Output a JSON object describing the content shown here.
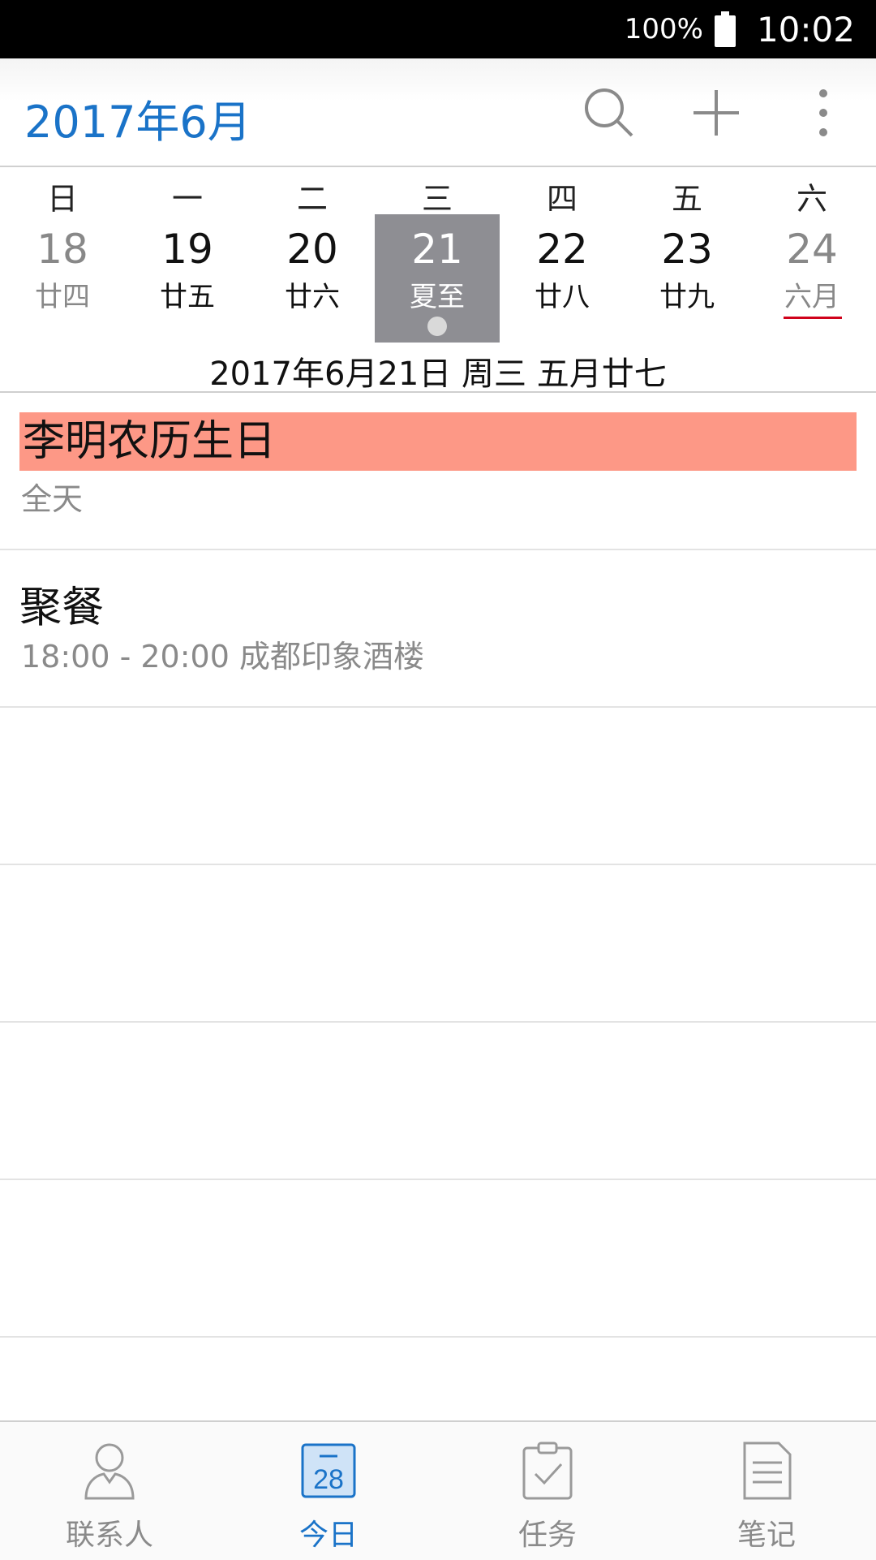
{
  "status_bar": {
    "battery": "100%",
    "time": "10:02"
  },
  "app_bar": {
    "title": "2017年6月",
    "actions": [
      "search-icon",
      "add-icon",
      "more-vertical-icon"
    ]
  },
  "week": {
    "headers": [
      "日",
      "一",
      "二",
      "三",
      "四",
      "五",
      "六"
    ],
    "days": [
      {
        "num": "18",
        "lunar": "廿四"
      },
      {
        "num": "19",
        "lunar": "廿五"
      },
      {
        "num": "20",
        "lunar": "廿六"
      },
      {
        "num": "21",
        "lunar": "夏至"
      },
      {
        "num": "22",
        "lunar": "廿八"
      },
      {
        "num": "23",
        "lunar": "廿九"
      },
      {
        "num": "24",
        "lunar": "六月"
      }
    ],
    "selected_index": 3,
    "selected_date_text": "2017年6月21日 周三 五月廿七"
  },
  "events": [
    {
      "title": "李明农历生日",
      "subtitle": "全天",
      "color": "#fd9886"
    },
    {
      "title": "聚餐",
      "subtitle": "18:00 - 20:00  成都印象酒楼"
    }
  ],
  "bottom_nav": {
    "items": [
      {
        "label": "联系人",
        "icon": "contacts-icon"
      },
      {
        "label": "今日",
        "icon": "calendar-today-icon",
        "icon_text": "28"
      },
      {
        "label": "任务",
        "icon": "task-clipboard-icon"
      },
      {
        "label": "笔记",
        "icon": "note-icon"
      }
    ],
    "active_index": 1
  },
  "colors": {
    "accent": "#1a73c8",
    "selected_day": "#8e8e93",
    "event_highlight": "#fd9886",
    "holiday_underline": "#d0021b"
  }
}
